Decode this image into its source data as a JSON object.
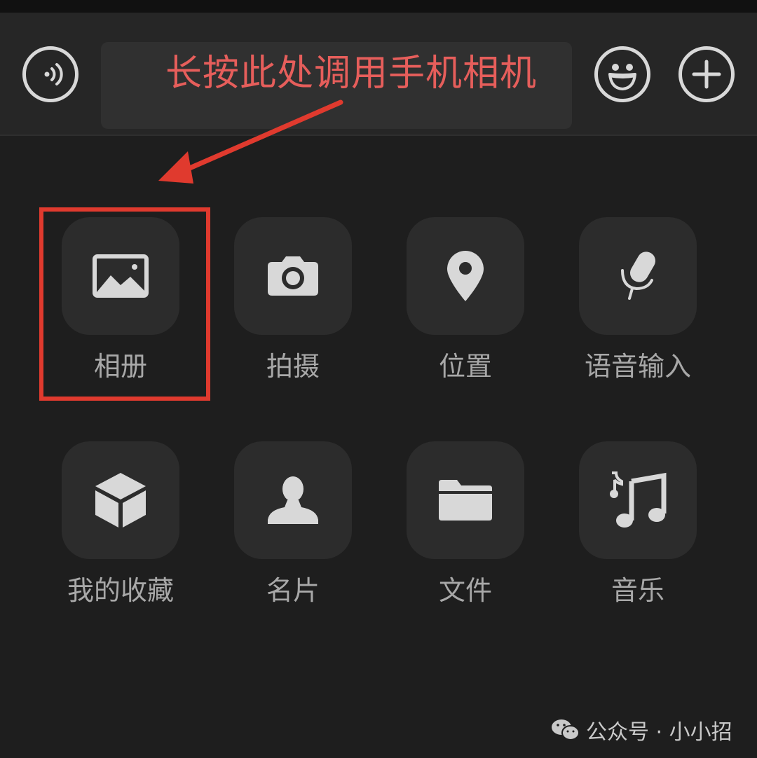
{
  "input_bar": {
    "callout_text": "长按此处调用手机相机"
  },
  "more_panel": {
    "items": [
      {
        "label": "相册",
        "icon": "photo-album-icon"
      },
      {
        "label": "拍摄",
        "icon": "camera-icon"
      },
      {
        "label": "位置",
        "icon": "location-pin-icon"
      },
      {
        "label": "语音输入",
        "icon": "microphone-icon"
      },
      {
        "label": "我的收藏",
        "icon": "favorites-cube-icon"
      },
      {
        "label": "名片",
        "icon": "contact-card-icon"
      },
      {
        "label": "文件",
        "icon": "folder-icon"
      },
      {
        "label": "音乐",
        "icon": "music-note-icon"
      }
    ]
  },
  "watermark": {
    "text": "公众号 · 小小招"
  },
  "colors": {
    "background": "#1e1e1e",
    "tile": "#2c2c2c",
    "icon": "#d8d8d8",
    "label": "#a8a8a8",
    "callout": "#e65e5b",
    "annotation_red": "#e03a2e"
  }
}
